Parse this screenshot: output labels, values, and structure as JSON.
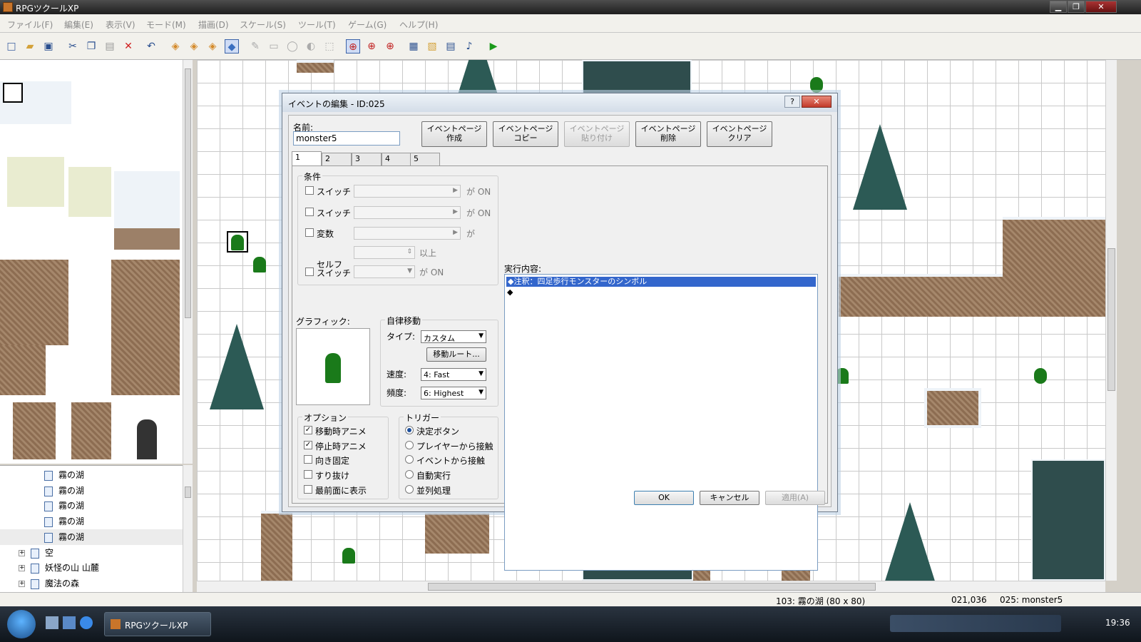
{
  "window": {
    "title": "RPGツクールXP",
    "minimize": "▁",
    "maximize": "❐",
    "close": "✕"
  },
  "menu": [
    "ファイル(F)",
    "編集(E)",
    "表示(V)",
    "モード(M)",
    "描画(D)",
    "スケール(S)",
    "ツール(T)",
    "ゲーム(G)",
    "ヘルプ(H)"
  ],
  "toolbar": [
    {
      "icon": "new-file-icon",
      "glyph": "□"
    },
    {
      "icon": "open-folder-icon",
      "glyph": "▰"
    },
    {
      "icon": "save-icon",
      "glyph": "▣"
    },
    {
      "icon": "cut-icon",
      "glyph": "✂"
    },
    {
      "icon": "copy-icon",
      "glyph": "❐"
    },
    {
      "icon": "paste-icon",
      "glyph": "▤"
    },
    {
      "icon": "delete-icon",
      "glyph": "✕"
    },
    {
      "icon": "undo-icon",
      "glyph": "↶"
    },
    {
      "icon": "layer1-icon",
      "glyph": "◈"
    },
    {
      "icon": "layer2-icon",
      "glyph": "◈"
    },
    {
      "icon": "layer3-icon",
      "glyph": "◈"
    },
    {
      "icon": "event-layer-icon",
      "glyph": "◆"
    },
    {
      "icon": "pencil-icon",
      "glyph": "✎"
    },
    {
      "icon": "rectangle-icon",
      "glyph": "▭"
    },
    {
      "icon": "ellipse-icon",
      "glyph": "◯"
    },
    {
      "icon": "fill-icon",
      "glyph": "◐"
    },
    {
      "icon": "select-icon",
      "glyph": "⬚"
    },
    {
      "icon": "zoom-1-icon",
      "glyph": "⊕"
    },
    {
      "icon": "zoom-2-icon",
      "glyph": "⊕"
    },
    {
      "icon": "zoom-4-icon",
      "glyph": "⊕"
    },
    {
      "icon": "database-icon",
      "glyph": "▦"
    },
    {
      "icon": "material-icon",
      "glyph": "▧"
    },
    {
      "icon": "script-icon",
      "glyph": "▤"
    },
    {
      "icon": "sound-icon",
      "glyph": "♪"
    },
    {
      "icon": "play-icon",
      "glyph": "▶"
    }
  ],
  "tree": [
    {
      "label": "霧の湖",
      "type": "page"
    },
    {
      "label": "霧の湖",
      "type": "page"
    },
    {
      "label": "霧の湖",
      "type": "page"
    },
    {
      "label": "霧の湖",
      "type": "page"
    },
    {
      "label": "霧の湖",
      "type": "page",
      "selected": true
    },
    {
      "label": "空",
      "type": "folder"
    },
    {
      "label": "妖怪の山 山麓",
      "type": "folder"
    },
    {
      "label": "魔法の森",
      "type": "folder"
    }
  ],
  "tree_expander": "+",
  "status": {
    "map": "103: 霧の湖 (80 x 80)",
    "coord": "021,036",
    "event": "025: monster5"
  },
  "taskbar": {
    "app": "RPGツクールXP",
    "clock": "19:36"
  },
  "dialog": {
    "title": "イベントの編集 - ID:025",
    "help": "?",
    "close": "✕",
    "name_label": "名前:",
    "name_value": "monster5",
    "page_buttons": [
      {
        "line1": "イベントページ",
        "line2": "作成",
        "enabled": true
      },
      {
        "line1": "イベントページ",
        "line2": "コピー",
        "enabled": true
      },
      {
        "line1": "イベントページ",
        "line2": "貼り付け",
        "enabled": false
      },
      {
        "line1": "イベントページ",
        "line2": "削除",
        "enabled": true
      },
      {
        "line1": "イベントページ",
        "line2": "クリア",
        "enabled": true
      }
    ],
    "tabs": [
      "1",
      "2",
      "3",
      "4",
      "5"
    ],
    "conditions": {
      "label": "条件",
      "switch1": "スイッチ",
      "switch2": "スイッチ",
      "variable": "変数",
      "self_switch_line1": "セルフ",
      "self_switch_line2": "スイッチ",
      "on1": "が ON",
      "on2": "が ON",
      "ga": "が",
      "ijou": "以上",
      "on3": "が ON"
    },
    "graphic_label": "グラフィック:",
    "movement": {
      "label": "自律移動",
      "type_label": "タイプ:",
      "type_value": "カスタム",
      "route_button": "移動ルート...",
      "speed_label": "速度:",
      "speed_value": "4: Fast",
      "freq_label": "頻度:",
      "freq_value": "6: Highest"
    },
    "options": {
      "label": "オプション",
      "items": [
        {
          "label": "移動時アニメ",
          "checked": true
        },
        {
          "label": "停止時アニメ",
          "checked": true
        },
        {
          "label": "向き固定",
          "checked": false
        },
        {
          "label": "すり抜け",
          "checked": false
        },
        {
          "label": "最前面に表示",
          "checked": false
        }
      ]
    },
    "trigger": {
      "label": "トリガー",
      "items": [
        {
          "label": "決定ボタン",
          "selected": true
        },
        {
          "label": "プレイヤーから接触",
          "selected": false
        },
        {
          "label": "イベントから接触",
          "selected": false
        },
        {
          "label": "自動実行",
          "selected": false
        },
        {
          "label": "並列処理",
          "selected": false
        }
      ]
    },
    "commands_label": "実行内容:",
    "commands": [
      "◆注釈：四足歩行モンスターのシンボル",
      "◆"
    ],
    "ok": "OK",
    "cancel": "キャンセル",
    "apply": "適用(A)"
  }
}
